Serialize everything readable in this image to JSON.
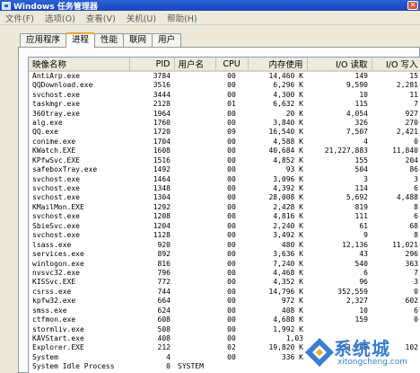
{
  "window": {
    "title": "Windows 任务管理器"
  },
  "menu": [
    "文件(F)",
    "选项(O)",
    "查看(V)",
    "关机(U)",
    "帮助(H)"
  ],
  "tabs": [
    {
      "label": "应用程序",
      "active": false
    },
    {
      "label": "进程",
      "active": true
    },
    {
      "label": "性能",
      "active": false
    },
    {
      "label": "联网",
      "active": false
    },
    {
      "label": "用户",
      "active": false
    }
  ],
  "columns": [
    "映像名称",
    "PID",
    "用户名",
    "CPU",
    "内存使用",
    "I/O 读取",
    "I/O 写入"
  ],
  "rows": [
    [
      "AntiArp.exe",
      "3784",
      "",
      "00",
      "14,460 K",
      "149",
      "15"
    ],
    [
      "QQDownload.exe",
      "3516",
      "",
      "00",
      "6,296 K",
      "9,590",
      "2,281"
    ],
    [
      "svchost.exe",
      "3444",
      "",
      "00",
      "4,300 K",
      "10",
      "11"
    ],
    [
      "taskmgr.exe",
      "2128",
      "",
      "01",
      "6,632 K",
      "115",
      "7"
    ],
    [
      "360tray.exe",
      "1964",
      "",
      "00",
      "20 K",
      "4,054",
      "927"
    ],
    [
      "alg.exe",
      "1760",
      "",
      "00",
      "3,840 K",
      "326",
      "270"
    ],
    [
      "QQ.exe",
      "1720",
      "",
      "09",
      "16,540 K",
      "7,507",
      "2,421"
    ],
    [
      "conime.exe",
      "1704",
      "",
      "00",
      "4,588 K",
      "4",
      "0"
    ],
    [
      "KWatch.EXE",
      "1608",
      "",
      "00",
      "40,684 K",
      "21,227,883",
      "11,840"
    ],
    [
      "KPfwSvc.EXE",
      "1516",
      "",
      "00",
      "4,852 K",
      "155",
      "204"
    ],
    [
      "safeboxTray.exe",
      "1492",
      "",
      "00",
      "93 K",
      "504",
      "86"
    ],
    [
      "svchost.exe",
      "1464",
      "",
      "00",
      "3,096 K",
      "3",
      "3"
    ],
    [
      "svchost.exe",
      "1348",
      "",
      "00",
      "4,392 K",
      "114",
      "6"
    ],
    [
      "svchost.exe",
      "1304",
      "",
      "00",
      "28,008 K",
      "5,692",
      "4,488"
    ],
    [
      "KMailMon.EXE",
      "1292",
      "",
      "00",
      "2,428 K",
      "819",
      "8"
    ],
    [
      "svchost.exe",
      "1208",
      "",
      "00",
      "4,816 K",
      "111",
      "6"
    ],
    [
      "SbieSvc.exe",
      "1204",
      "",
      "00",
      "2,240 K",
      "61",
      "68"
    ],
    [
      "svchost.exe",
      "1128",
      "",
      "00",
      "3,492 K",
      "9",
      "8"
    ],
    [
      "lsass.exe",
      "920",
      "",
      "00",
      "480 K",
      "12,136",
      "11,021"
    ],
    [
      "services.exe",
      "892",
      "",
      "00",
      "3,636 K",
      "43",
      "296"
    ],
    [
      "winlogon.exe",
      "816",
      "",
      "00",
      "7,240 K",
      "540",
      "363"
    ],
    [
      "nvsvc32.exe",
      "796",
      "",
      "00",
      "4,468 K",
      "6",
      "7"
    ],
    [
      "KISSvc.EXE",
      "772",
      "",
      "00",
      "4,352 K",
      "96",
      "3"
    ],
    [
      "csrss.exe",
      "744",
      "",
      "00",
      "14,796 K",
      "352,559",
      "0"
    ],
    [
      "kpfw32.exe",
      "664",
      "",
      "00",
      "972 K",
      "2,327",
      "602"
    ],
    [
      "smss.exe",
      "624",
      "",
      "00",
      "408 K",
      "10",
      "6"
    ],
    [
      "ctfmon.exe",
      "608",
      "",
      "00",
      "4,688 K",
      "159",
      "0"
    ],
    [
      "stormliv.exe",
      "508",
      "",
      "00",
      "1,992 K",
      "",
      ""
    ],
    [
      "KAVStart.exe",
      "408",
      "",
      "00",
      "1,03",
      "",
      ""
    ],
    [
      "Explorer.EXE",
      "212",
      "",
      "02",
      "19,820 K",
      "33,785",
      "102"
    ],
    [
      "System",
      "4",
      "",
      "00",
      "336 K",
      "",
      ""
    ],
    [
      "System Idle Process",
      "0",
      "SYSTEM",
      "",
      "",
      "",
      ""
    ]
  ],
  "watermark": {
    "text": "系统城",
    "url": "xitongcheng.com"
  }
}
